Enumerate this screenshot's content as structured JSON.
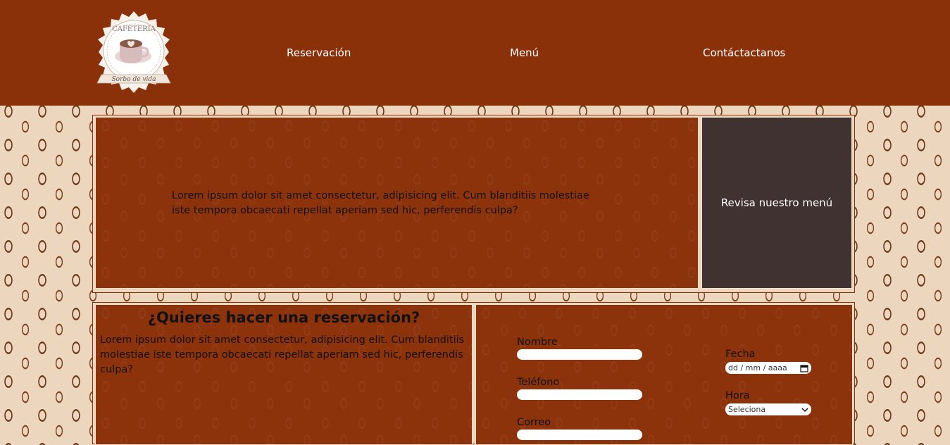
{
  "logo": {
    "top_text": "CAFETERIA",
    "bottom_text": "Sorbo de vida"
  },
  "nav": {
    "items": [
      "Reservación",
      "Menú",
      "Contáctactanos"
    ]
  },
  "hero": {
    "text": "Lorem ipsum dolor sit amet consectetur, adipisicing elit. Cum blanditiis molestiae iste tempora obcaecati repellat aperiam sed hic, perferendis culpa?"
  },
  "menu_cta": {
    "label": "Revisa nuestro menú"
  },
  "reservation": {
    "title": "¿Quieres hacer una reservación?",
    "text": "Lorem ipsum dolor sit amet consectetur, adipisicing elit. Cum blanditiis molestiae iste tempora obcaecati repellat aperiam sed hic, perferendis culpa?"
  },
  "form": {
    "name_label": "Nombre",
    "phone_label": "Teléfono",
    "email_label": "Correo",
    "date_label": "Fecha",
    "date_placeholder": "dd / mm / aaaa",
    "time_label": "Hora",
    "time_selected": "Seleciona"
  },
  "colors": {
    "header_bg": "#8b310a",
    "box_bg": "#8c330b",
    "menu_box_bg": "#3f3230",
    "page_bg": "#ecd6bd"
  }
}
